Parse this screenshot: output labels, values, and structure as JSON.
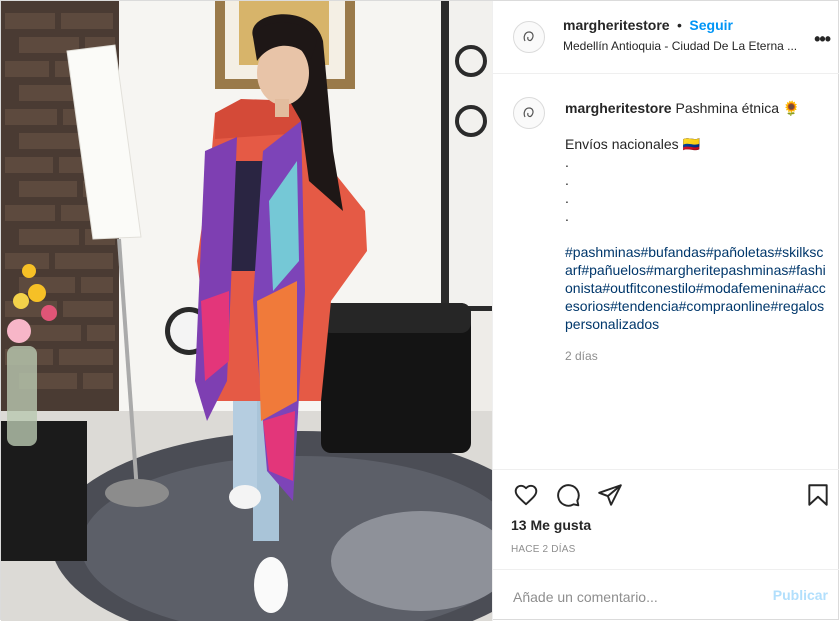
{
  "post": {
    "username": "margheritestore",
    "follow_label": "Seguir",
    "separator": "•",
    "location": "Medellín Antioquia - Ciudad De La Eterna ...",
    "more_label": "•••"
  },
  "caption": {
    "username": "margheritestore",
    "title": "Pashmina étnica 🌻",
    "shipping": "Envíos nacionales 🇨🇴",
    "dots": [
      ".",
      ".",
      ".",
      "."
    ],
    "hashtags": "#pashminas#bufandas#pañoletas#skilkscarf#pañuelos#margheritepashminas#fashionista#outfitconestilo#modafemenina#accesorios#tendencia#compraonline#regalospersonalizados",
    "time": "2 días"
  },
  "actions": {
    "icons": [
      "heart-icon",
      "comment-icon",
      "share-icon",
      "bookmark-icon"
    ],
    "likes": "13 Me gusta",
    "ago": "HACE 2 DÍAS"
  },
  "comment": {
    "placeholder": "Añade un comentario...",
    "publish_label": "Publicar"
  },
  "colors": {
    "link": "#0095f6",
    "hashtag": "#00376b",
    "muted": "#8e8e8e",
    "publish_disabled": "#b2dffc"
  }
}
